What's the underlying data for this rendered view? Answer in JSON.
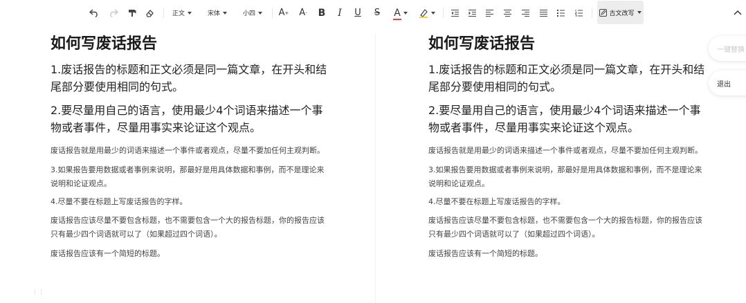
{
  "toolbar": {
    "style": "正文",
    "font": "宋体",
    "size": "小四",
    "bold": "B",
    "italic": "I",
    "underline": "U",
    "strike": "S",
    "font_color": "A",
    "font_color_hex": "#e0453a",
    "highlight_hex": "#f5d142",
    "font_up": "A",
    "font_down": "A",
    "ancient_rewrite": "古文改写"
  },
  "side": {
    "one_click": "一键替换",
    "exit": "退出"
  },
  "docs": [
    {
      "title": "如何写废话报告",
      "h2_1": "1.废话报告的标题和正文必须是同一篇文章，在开头和结尾部分要使用相同的句式。",
      "h2_2": "2.要尽量用自己的语言，使用最少4个词语来描述一个事物或者事件，尽量用事实来论证这个观点。",
      "p1": "废话报告就是用最少的词语来描述一个事件或者观点，尽量不要加任何主观判断。",
      "p2": "3.如果报告要用数据或者事例来说明，那最好是用具体数据和事例，而不是理论来说明和论证观点。",
      "p3": "4.尽量不要在标题上写废话报告的字样。",
      "p4": "废话报告应该尽量不要包含标题，也不需要包含一个大的报告标题，你的报告应该只有最少四个词语就可以了（如果超过四个词语）。",
      "p5": "废话报告应该有一个简短的标题。"
    },
    {
      "title": "如何写废话报告",
      "h2_1": "1.废话报告的标题和正文必须是同一篇文章，在开头和结尾部分要使用相同的句式。",
      "h2_2": "2.要尽量用自己的语言，使用最少4个词语来描述一个事物或者事件，尽量用事实来论证这个观点。",
      "p1": "废话报告就是用最少的词语来描述一个事件或者观点，尽量不要加任何主观判断。",
      "p2": "3.如果报告要用数据或者事例来说明，那最好是用具体数据和事例，而不是理论来说明和论证观点。",
      "p3": "4.尽量不要在标题上写废话报告的字样。",
      "p4": "废话报告应该尽量不要包含标题，也不需要包含一个大的报告标题，你的报告应该只有最少四个词语就可以了（如果超过四个词语）。",
      "p5": "废话报告应该有一个简短的标题。"
    }
  ]
}
